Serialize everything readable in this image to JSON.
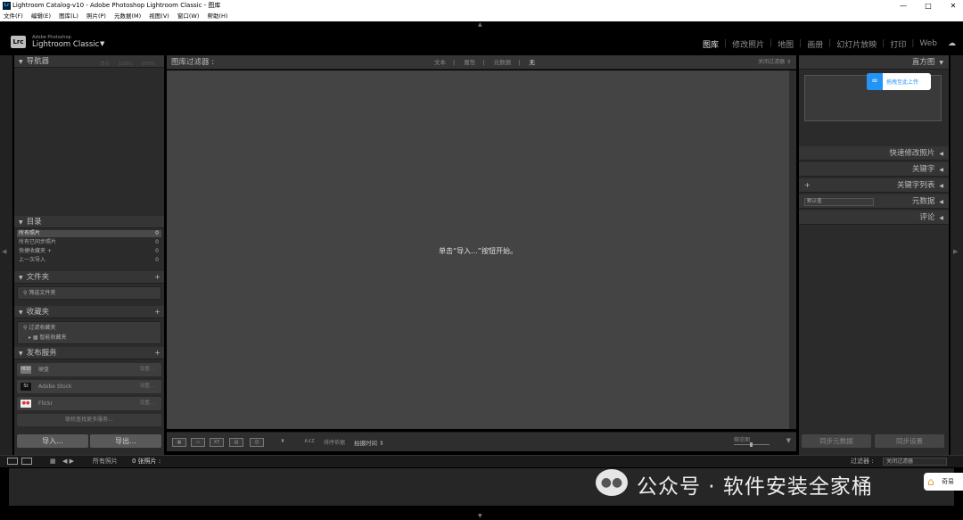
{
  "window": {
    "title": "Lightroom Catalog-v10 - Adobe Photoshop Lightroom Classic - 图库",
    "app_icon": "Lr",
    "controls": {
      "minimize": "—",
      "maximize": "□",
      "close": "✕"
    }
  },
  "menubar": [
    "文件(F)",
    "编辑(E)",
    "图库(L)",
    "照片(P)",
    "元数据(M)",
    "视图(V)",
    "窗口(W)",
    "帮助(H)"
  ],
  "identity": {
    "logo": "Lrc",
    "small": "Adobe Photoshop",
    "name": "Lightroom Classic",
    "caret": "▼"
  },
  "modules": [
    {
      "label": "图库",
      "active": true
    },
    {
      "label": "修改照片",
      "active": false
    },
    {
      "label": "地图",
      "active": false
    },
    {
      "label": "画册",
      "active": false
    },
    {
      "label": "幻灯片放映",
      "active": false
    },
    {
      "label": "打印",
      "active": false
    },
    {
      "label": "Web",
      "active": false
    }
  ],
  "left_panel": {
    "navigator": {
      "title": "导航器",
      "options": "适合 100% 300%"
    },
    "catalog": {
      "title": "目录",
      "rows": [
        {
          "label": "所有照片",
          "count": "0",
          "selected": true
        },
        {
          "label": "所有已同步照片",
          "count": "0",
          "selected": false
        },
        {
          "label": "快捷收藏夹 +",
          "count": "0",
          "selected": false
        },
        {
          "label": "上一次导入",
          "count": "0",
          "selected": false
        }
      ]
    },
    "folders": {
      "title": "文件夹",
      "plus": "+",
      "row": "筛选文件夹"
    },
    "collections": {
      "title": "收藏夹",
      "plus": "+",
      "row1": "过滤收藏夹",
      "row2": "智能收藏夹"
    },
    "publish": {
      "title": "发布服务",
      "plus": "+",
      "services": [
        {
          "icon": "HDD",
          "label": "硬盘",
          "setup": "设置..."
        },
        {
          "icon": "St",
          "label": "Adobe Stock",
          "setup": "设置..."
        },
        {
          "icon": "●●",
          "label": "Flickr",
          "setup": "设置..."
        }
      ],
      "more": "联机查找更多服务..."
    },
    "import_label": "导入...",
    "export_label": "导出..."
  },
  "center": {
    "filter_title": "图库过滤器 :",
    "filter_options": [
      {
        "label": "文本",
        "selected": false
      },
      {
        "label": "属性",
        "selected": false
      },
      {
        "label": "元数据",
        "selected": false
      },
      {
        "label": "无",
        "selected": true
      }
    ],
    "filter_lock": "关闭过滤器 ⇕",
    "empty_message": "单击“导入...”按钮开始。",
    "toolbar": {
      "sort_label": "排序依据",
      "sort_value": "拍摄时间 ⇕",
      "thumb_label": "缩览图",
      "caret": "▼"
    }
  },
  "right_panel": {
    "histogram": "直方图",
    "upload_badge": "拖拽至此上传",
    "quick_develop": "快速修改照片",
    "keywording": "关键字",
    "keyword_list": "关键字列表",
    "keyword_plus": "+",
    "metadata": "元数据",
    "metadata_preset": "默认值",
    "comments": "评论",
    "sync_metadata": "同步元数据",
    "sync_settings": "同步设置"
  },
  "filmstrip": {
    "source": "所有照片",
    "count": "0 张照片 :",
    "filter_label": "过滤器 :",
    "filter_value": "关闭过滤器"
  },
  "watermark": {
    "text": "公众号 · 软件安装全家桶",
    "side_label": "奇易"
  }
}
